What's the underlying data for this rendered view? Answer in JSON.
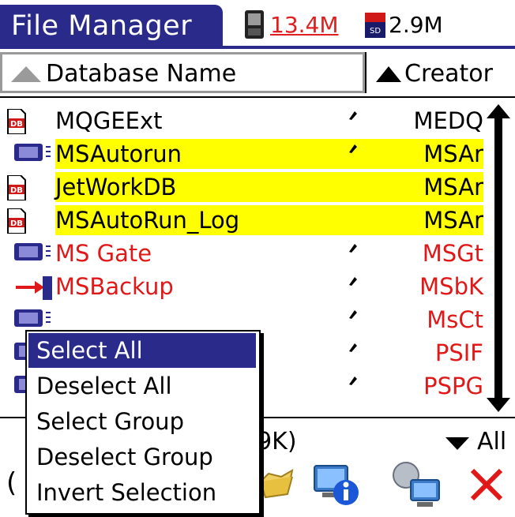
{
  "titlebar": {
    "title": "File Manager",
    "ram_free": "13.4M",
    "card_free": "2.9M",
    "ram_icon": "handheld-device-icon",
    "card_icon": "sd-card-icon"
  },
  "header": {
    "name_label": "Database Name",
    "creator_label": "Creator",
    "sort_icon": "sort-ascending-icon"
  },
  "rows": [
    {
      "name": "MQGEExt",
      "creator": "MEDQ",
      "marked": true,
      "highlighted": false,
      "color": "#000000",
      "icon": "database-file-icon"
    },
    {
      "name": "MSAutorun",
      "creator": "MSAr",
      "marked": true,
      "highlighted": true,
      "color": "#000000",
      "icon": "application-icon"
    },
    {
      "name": "JetWorkDB",
      "creator": "MSAr",
      "marked": false,
      "highlighted": true,
      "color": "#000000",
      "icon": "database-file-icon"
    },
    {
      "name": "MSAutoRun_Log",
      "creator": "MSAr",
      "marked": false,
      "highlighted": true,
      "color": "#000000",
      "icon": "database-file-icon"
    },
    {
      "name": "MS Gate",
      "creator": "MSGt",
      "marked": true,
      "highlighted": false,
      "color": "#e01818",
      "icon": "application-icon"
    },
    {
      "name": "MSBackup",
      "creator": "MSbK",
      "marked": true,
      "highlighted": false,
      "color": "#e01818",
      "icon": "backup-app-icon"
    },
    {
      "name": "",
      "creator": "MsCt",
      "marked": true,
      "highlighted": false,
      "color": "#e01818",
      "icon": "application-icon"
    },
    {
      "name": "",
      "creator": "PSIF",
      "marked": true,
      "highlighted": false,
      "color": "#e01818",
      "icon": "application-icon"
    },
    {
      "name": "",
      "creator": "PSPG",
      "marked": true,
      "highlighted": false,
      "color": "#e01818",
      "icon": "application-icon"
    }
  ],
  "footer": {
    "size": "19K)",
    "filter": "All",
    "paren": "("
  },
  "toolbar": {
    "icons": [
      "folder-icon",
      "info-icon",
      "network-icon",
      "delete-icon"
    ]
  },
  "menu": {
    "items": [
      "Select All",
      "Deselect All",
      "Select Group",
      "Deselect Group",
      "Invert Selection"
    ],
    "selected_index": 0
  },
  "colors": {
    "accent": "#2a2a8a",
    "highlight": "#ffff00",
    "red": "#e01818"
  }
}
